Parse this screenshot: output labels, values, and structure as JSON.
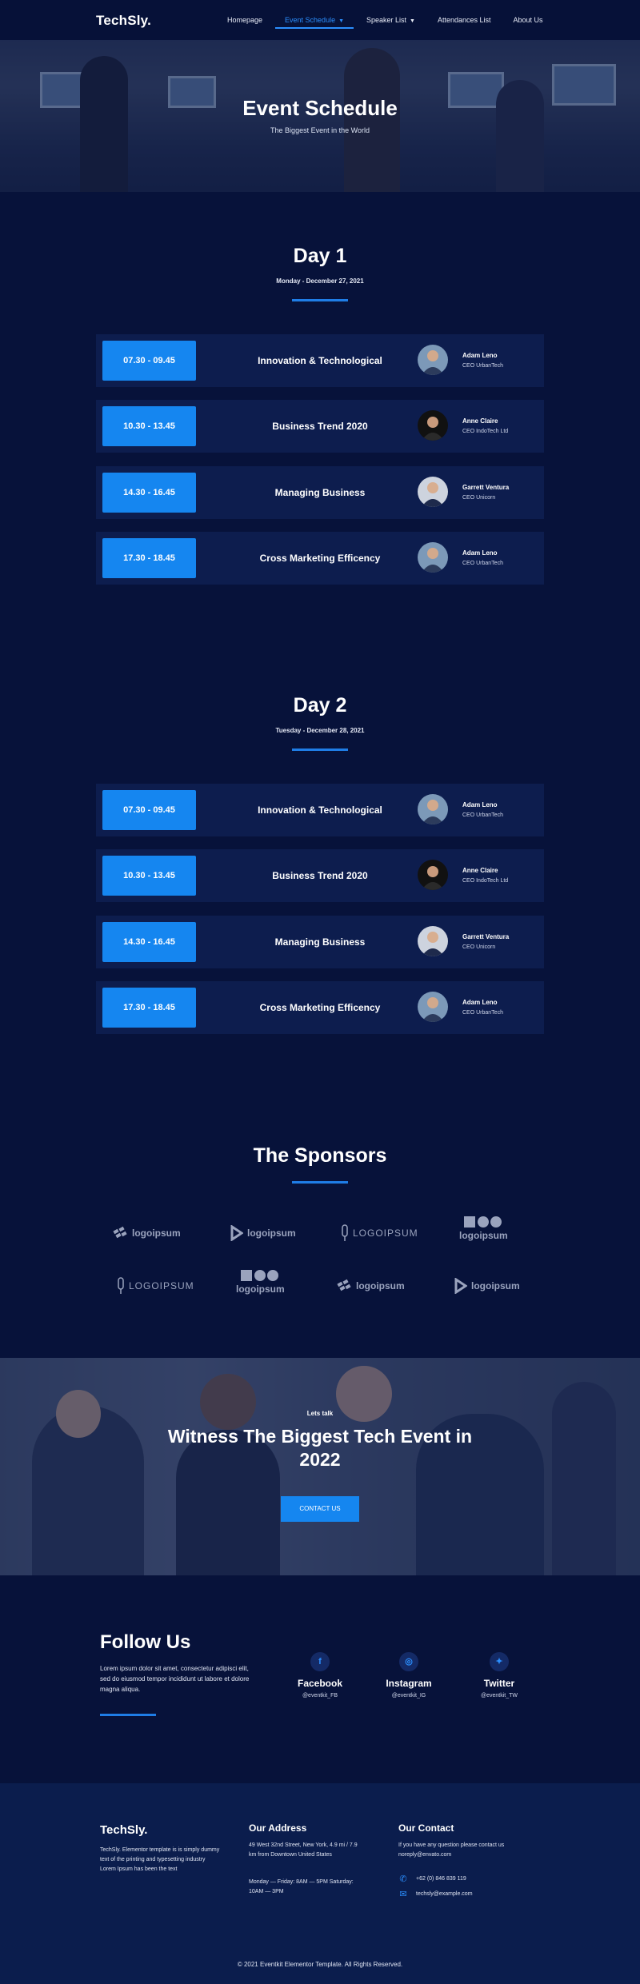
{
  "nav": {
    "logo": "TechSly.",
    "items": [
      {
        "label": "Homepage"
      },
      {
        "label": "Event Schedule"
      },
      {
        "label": "Speaker List"
      },
      {
        "label": "Attendances List"
      },
      {
        "label": "About Us"
      }
    ]
  },
  "hero": {
    "title": "Event Schedule",
    "subtitle": "The Biggest Event in the World"
  },
  "days": [
    {
      "title": "Day 1",
      "date": "Monday - December 27, 2021",
      "sessions": [
        {
          "time": "07.30 - 09.45",
          "title": "Innovation & Technological",
          "speaker": "Adam Leno",
          "role": "CEO UrbanTech"
        },
        {
          "time": "10.30 - 13.45",
          "title": "Business Trend 2020",
          "speaker": "Anne Claire",
          "role": "CEO IndoTech Ltd"
        },
        {
          "time": "14.30 - 16.45",
          "title": "Managing Business",
          "speaker": "Garrett Ventura",
          "role": "CEO Unicorn"
        },
        {
          "time": "17.30 - 18.45",
          "title": "Cross Marketing Efficency",
          "speaker": "Adam Leno",
          "role": "CEO UrbanTech"
        }
      ]
    },
    {
      "title": "Day 2",
      "date": "Tuesday - December 28, 2021",
      "sessions": [
        {
          "time": "07.30 - 09.45",
          "title": "Innovation & Technological",
          "speaker": "Adam Leno",
          "role": "CEO UrbanTech"
        },
        {
          "time": "10.30 - 13.45",
          "title": "Business Trend 2020",
          "speaker": "Anne Claire",
          "role": "CEO IndoTech Ltd"
        },
        {
          "time": "14.30 - 16.45",
          "title": "Managing Business",
          "speaker": "Garrett Ventura",
          "role": "CEO Unicorn"
        },
        {
          "time": "17.30 - 18.45",
          "title": "Cross Marketing Efficency",
          "speaker": "Adam Leno",
          "role": "CEO UrbanTech"
        }
      ]
    }
  ],
  "sponsors": {
    "title": "The Sponsors",
    "logos": [
      "logoipsum",
      "logoipsum",
      "LOGOIPSUM",
      "logoipsum",
      "LOGOIPSUM",
      "logoipsum",
      "logoipsum",
      "logoipsum"
    ]
  },
  "cta": {
    "kicker": "Lets talk",
    "title": "Witness The Biggest Tech Event in 2022",
    "button": "CONTACT US"
  },
  "follow": {
    "title": "Follow Us",
    "text": "Lorem ipsum dolor sit amet, consectetur adipisci elit, sed do eiusmod tempor incididunt ut labore et dolore magna aliqua.",
    "socials": [
      {
        "icon": "facebook-icon",
        "name": "Facebook",
        "handle": "@eventkit_FB"
      },
      {
        "icon": "instagram-icon",
        "name": "Instagram",
        "handle": "@eventkit_IG"
      },
      {
        "icon": "twitter-icon",
        "name": "Twitter",
        "handle": "@eventkit_TW"
      }
    ]
  },
  "footer": {
    "logo": "TechSly.",
    "about": "TechSly. Elementor template is is simply dummy text of the printing and typesetting industry Lorem Ipsum has been the text",
    "address_title": "Our Address",
    "address": "49 West 32nd Street, New York, 4.9 mi / 7.9 km from Downtown United States",
    "hours": "Monday — Friday: 8AM — 5PM Saturday: 10AM — 3PM",
    "contact_title": "Our Contact",
    "contact_text": "If you have any question please contact us noreply@envato.com",
    "phone": "+62 (0) 846 839 119",
    "email": "techsly@example.com",
    "copyright": "© 2021 Eventkit Elementor Template. All Rights Reserved."
  },
  "colors": {
    "background": "#07123a",
    "accent": "#1586f0",
    "card": "#0d1d4e"
  }
}
